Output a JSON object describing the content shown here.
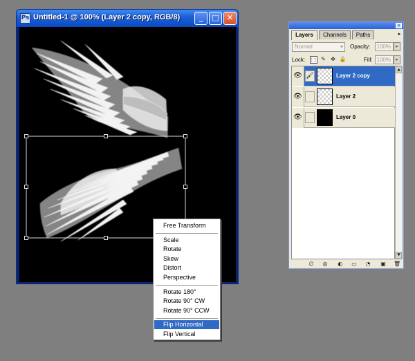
{
  "document_window": {
    "app_icon_text": "Ps",
    "title": "Untitled-1 @ 100% (Layer 2 copy, RGB/8)",
    "minimize_glyph": "_",
    "maximize_glyph": "□",
    "close_glyph": "✕"
  },
  "context_menu": {
    "items": [
      "Free Transform",
      "Scale",
      "Rotate",
      "Skew",
      "Distort",
      "Perspective",
      "Rotate 180°",
      "Rotate 90° CW",
      "Rotate 90° CCW",
      "Flip Horizontal",
      "Flip Vertical"
    ],
    "selected_item": "Flip Horizontal"
  },
  "layers_palette": {
    "close_glyph": "×",
    "menu_glyph": "▸",
    "tabs": [
      "Layers",
      "Channels",
      "Paths"
    ],
    "active_tab": "Layers",
    "blend_mode": "Normal",
    "opacity_label": "Opacity:",
    "opacity_value": "100%",
    "lock_label": "Lock:",
    "fill_label": "Fill:",
    "fill_value": "100%",
    "arrow_glyph": "▸",
    "layers": [
      {
        "name": "Layer 2 copy",
        "selected": true,
        "linked_glyph": "🖌"
      },
      {
        "name": "Layer 2",
        "selected": false
      },
      {
        "name": "Layer 0",
        "selected": false
      }
    ],
    "eye_glyph": "👁",
    "lock_glyphs": [
      "⬚",
      "✎",
      "✥",
      "🔒"
    ],
    "bottom_glyphs": [
      "∅",
      "◎",
      "◐",
      "▭",
      "◔",
      "▣",
      "🗑"
    ],
    "scroll_up_glyph": "▲",
    "scroll_down_glyph": "▼"
  },
  "colors": {
    "selection_blue": "#316ac5",
    "canvas_bg": "#000000",
    "workspace_bg": "#7f7f7f"
  },
  "icons": {
    "app": "photoshop-document-icon",
    "visibility": "eye-icon",
    "brush": "brush-icon",
    "trash": "trash-icon"
  }
}
